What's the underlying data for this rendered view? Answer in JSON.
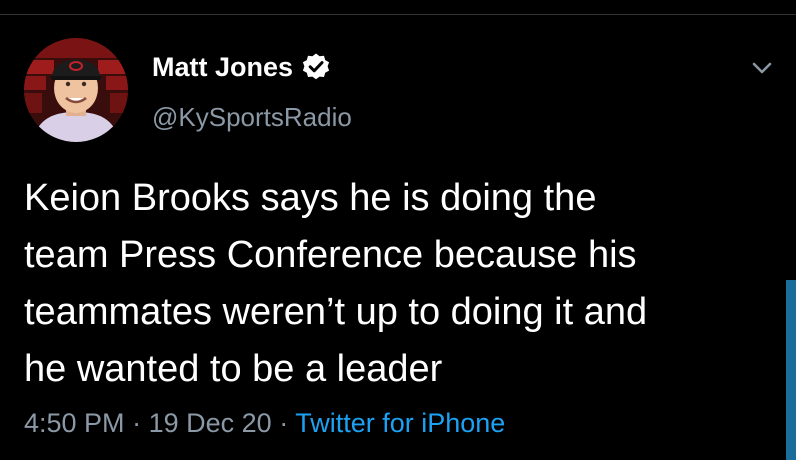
{
  "tweet": {
    "author": {
      "display_name": "Matt Jones",
      "handle": "@KySportsRadio",
      "verified": true,
      "verified_icon": "verified-badge-icon",
      "avatar_icon": "profile-photo"
    },
    "text_lines": [
      "Keion Brooks says he is doing the",
      "team Press Conference because his",
      "teammates weren’t up to doing it and",
      "he wanted to be a leader"
    ],
    "time": "4:50 PM",
    "separator": "·",
    "date": "19 Dec 20",
    "source": "Twitter for iPhone",
    "menu_icon": "chevron-down-icon"
  },
  "colors": {
    "background": "#000000",
    "text": "#ffffff",
    "secondary_text": "#8b98a5",
    "link": "#1da1f2"
  }
}
